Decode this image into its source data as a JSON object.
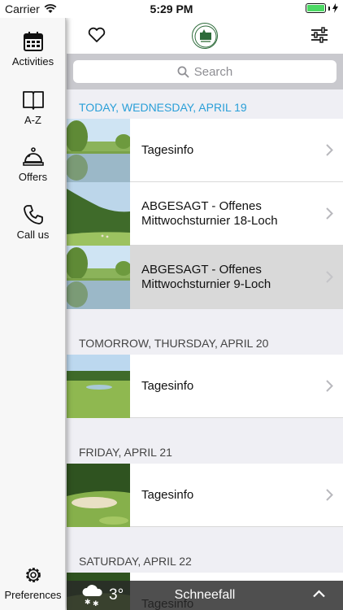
{
  "status_bar": {
    "carrier": "Carrier",
    "time": "5:29 PM"
  },
  "sidebar": {
    "items": [
      {
        "label": "Activities",
        "icon": "calendar-icon",
        "active": true
      },
      {
        "label": "A-Z",
        "icon": "book-icon",
        "active": false
      },
      {
        "label": "Offers",
        "icon": "service-bell-icon",
        "active": false
      },
      {
        "label": "Call us",
        "icon": "phone-icon",
        "active": false
      },
      {
        "label": "Preferences",
        "icon": "gear-icon",
        "active": false
      }
    ]
  },
  "topbar": {
    "left_icon": "heart-icon",
    "right_icon": "filter-sliders-icon",
    "logo": "club-logo"
  },
  "search": {
    "placeholder": "Search"
  },
  "sections": [
    {
      "header": "TODAY, WEDNESDAY, APRIL 19",
      "rows": [
        {
          "title": "Tagesinfo"
        },
        {
          "title": "ABGESAGT - Offenes Mittwochsturnier 18-Loch"
        },
        {
          "title": "ABGESAGT - Offenes Mittwochsturnier 9-Loch"
        }
      ]
    },
    {
      "header": "TOMORROW, THURSDAY, APRIL 20",
      "rows": [
        {
          "title": "Tagesinfo"
        }
      ]
    },
    {
      "header": "FRIDAY, APRIL 21",
      "rows": [
        {
          "title": "Tagesinfo"
        }
      ]
    },
    {
      "header": "SATURDAY, APRIL 22",
      "rows": [
        {
          "title": "Tagesinfo"
        }
      ]
    }
  ],
  "weather": {
    "temperature": "3°",
    "description": "Schneefall",
    "icon": "snow-cloud-icon"
  },
  "colors": {
    "accent": "#2a9fd8",
    "battery": "#4cd964",
    "highlight_row": "#d9d9d9"
  }
}
